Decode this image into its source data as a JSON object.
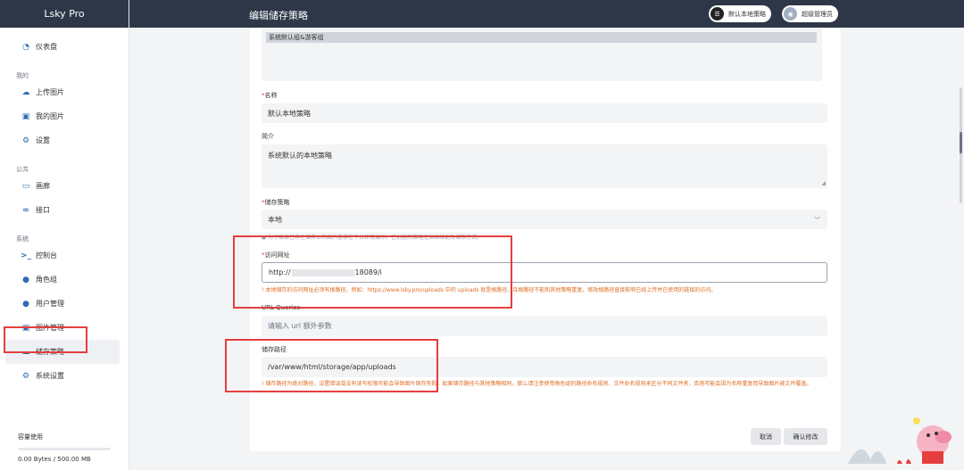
{
  "app": {
    "name": "Lsky Pro"
  },
  "header": {
    "title": "编辑储存策略",
    "policy_label": "默认本地策略",
    "user_label": "超级管理员"
  },
  "sidebar": {
    "dashboard": "仪表盘",
    "group_mine": "我的",
    "upload": "上传图片",
    "my_images": "我的图片",
    "settings": "设置",
    "group_public": "公共",
    "gallery": "画廊",
    "api": "接口",
    "group_system": "系统",
    "console": "控制台",
    "roles": "角色组",
    "users": "用户管理",
    "images": "图片管理",
    "storage": "储存策略",
    "system_settings": "系统设置",
    "capacity_label": "容量使用",
    "capacity_value": "0.00 Bytes / 500.00 MB",
    "capacity_fraction": 0.0
  },
  "form": {
    "group_chip": "系统默认组&游客组",
    "name_label": "名称",
    "name_value": "默认本地策略",
    "desc_label": "简介",
    "desc_value": "系统默认的本地策略",
    "strategy_label": "储存策略",
    "strategy_value": "本地",
    "strategy_hint": "为了确保已存在储存上的图片能够在平台正常展示，已创建的策略无法继续更改储存方式。",
    "url_label": "访问网址",
    "url_value_prefix": "http://",
    "url_value_suffix": "18089/i",
    "url_warn": "本地储存的访问网址必须有根路径，例如：https://www.lsky.pro/uploads 中的 uploads 就是根路径，且根路径不能和其他策略重复。修改根路径直接影响已经上传并已使用的链接的访问。",
    "query_label": "URL Queries",
    "query_placeholder": "请输入 url 额外参数",
    "path_label": "储存路径",
    "path_value": "/var/www/html/storage/app/uploads",
    "path_warn": "储存路径为绝对路径，设置错误或没有读写权限可能会导致图片保存失败。如果储存路径与其他策略相同，那么请注意使用角色组的路径命名规则、文件命名规则来区分不同文件夹，否则可能会因为名称重复而导致图片被文件覆盖。",
    "cancel_btn": "取消",
    "confirm_btn": "确认修改"
  },
  "colors": {
    "header_bg": "#2d3748",
    "warn": "#dd6b20",
    "required": "#e53e3e",
    "icon": "#2b6cb0"
  }
}
